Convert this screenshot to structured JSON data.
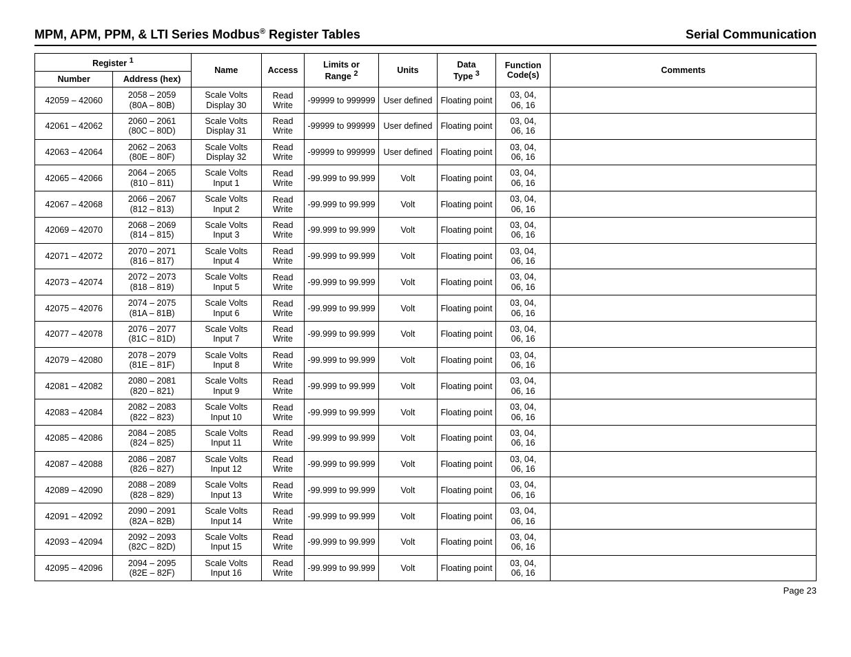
{
  "header": {
    "title_left_pre": "MPM, APM, PPM, & LTI Series Modbus",
    "title_left_post": " Register Tables",
    "reg_symbol": "®",
    "title_right": "Serial Communication"
  },
  "table": {
    "headers": {
      "register": "Register",
      "register_sup": "1",
      "number": "Number",
      "address": "Address (hex)",
      "name": "Name",
      "access": "Access",
      "limits_line1": "Limits or",
      "limits_line2": "Range",
      "limits_sup": "2",
      "units": "Units",
      "data_line1": "Data",
      "data_line2": "Type",
      "data_sup": "3",
      "function_line1": "Function",
      "function_line2": "Code(s)",
      "comments": "Comments"
    },
    "rows": [
      {
        "number": "42059 – 42060",
        "addr1": "2058 – 2059",
        "addr2": "(80A – 80B)",
        "name1": "Scale Volts",
        "name2": "Display 30",
        "access": "Read Write",
        "limits": "-99999 to 999999",
        "units": "User defined",
        "datatype": "Floating point",
        "func1": "03, 04,",
        "func2": "06, 16",
        "comments": ""
      },
      {
        "number": "42061 – 42062",
        "addr1": "2060 – 2061",
        "addr2": "(80C – 80D)",
        "name1": "Scale Volts",
        "name2": "Display 31",
        "access": "Read Write",
        "limits": "-99999 to 999999",
        "units": "User defined",
        "datatype": "Floating point",
        "func1": "03, 04,",
        "func2": "06, 16",
        "comments": ""
      },
      {
        "number": "42063 – 42064",
        "addr1": "2062 – 2063",
        "addr2": "(80E – 80F)",
        "name1": "Scale Volts",
        "name2": "Display 32",
        "access": "Read Write",
        "limits": "-99999 to 999999",
        "units": "User defined",
        "datatype": "Floating point",
        "func1": "03, 04,",
        "func2": "06, 16",
        "comments": ""
      },
      {
        "number": "42065 – 42066",
        "addr1": "2064 – 2065",
        "addr2": "(810 – 811)",
        "name1": "Scale Volts",
        "name2": "Input 1",
        "access": "Read Write",
        "limits": "-99.999 to 99.999",
        "units": "Volt",
        "datatype": "Floating point",
        "func1": "03, 04,",
        "func2": "06, 16",
        "comments": ""
      },
      {
        "number": "42067 – 42068",
        "addr1": "2066 – 2067",
        "addr2": "(812 – 813)",
        "name1": "Scale Volts",
        "name2": "Input 2",
        "access": "Read Write",
        "limits": "-99.999 to 99.999",
        "units": "Volt",
        "datatype": "Floating point",
        "func1": "03, 04,",
        "func2": "06, 16",
        "comments": ""
      },
      {
        "number": "42069 – 42070",
        "addr1": "2068 – 2069",
        "addr2": "(814 – 815)",
        "name1": "Scale Volts",
        "name2": "Input 3",
        "access": "Read Write",
        "limits": "-99.999 to 99.999",
        "units": "Volt",
        "datatype": "Floating point",
        "func1": "03, 04,",
        "func2": "06, 16",
        "comments": ""
      },
      {
        "number": "42071 – 42072",
        "addr1": "2070 – 2071",
        "addr2": "(816 – 817)",
        "name1": "Scale Volts",
        "name2": "Input 4",
        "access": "Read Write",
        "limits": "-99.999 to 99.999",
        "units": "Volt",
        "datatype": "Floating point",
        "func1": "03, 04,",
        "func2": "06, 16",
        "comments": ""
      },
      {
        "number": "42073 – 42074",
        "addr1": "2072 – 2073",
        "addr2": "(818 – 819)",
        "name1": "Scale Volts",
        "name2": "Input 5",
        "access": "Read Write",
        "limits": "-99.999 to 99.999",
        "units": "Volt",
        "datatype": "Floating point",
        "func1": "03, 04,",
        "func2": "06, 16",
        "comments": ""
      },
      {
        "number": "42075 – 42076",
        "addr1": "2074 – 2075",
        "addr2": "(81A – 81B)",
        "name1": "Scale Volts",
        "name2": "Input 6",
        "access": "Read Write",
        "limits": "-99.999 to 99.999",
        "units": "Volt",
        "datatype": "Floating point",
        "func1": "03, 04,",
        "func2": "06, 16",
        "comments": ""
      },
      {
        "number": "42077 – 42078",
        "addr1": "2076 – 2077",
        "addr2": "(81C – 81D)",
        "name1": "Scale Volts",
        "name2": "Input 7",
        "access": "Read Write",
        "limits": "-99.999 to 99.999",
        "units": "Volt",
        "datatype": "Floating point",
        "func1": "03, 04,",
        "func2": "06, 16",
        "comments": ""
      },
      {
        "number": "42079 – 42080",
        "addr1": "2078 – 2079",
        "addr2": "(81E – 81F)",
        "name1": "Scale Volts",
        "name2": "Input 8",
        "access": "Read Write",
        "limits": "-99.999 to 99.999",
        "units": "Volt",
        "datatype": "Floating point",
        "func1": "03, 04,",
        "func2": "06, 16",
        "comments": ""
      },
      {
        "number": "42081 – 42082",
        "addr1": "2080 – 2081",
        "addr2": "(820 – 821)",
        "name1": "Scale Volts",
        "name2": "Input 9",
        "access": "Read Write",
        "limits": "-99.999 to 99.999",
        "units": "Volt",
        "datatype": "Floating point",
        "func1": "03, 04,",
        "func2": "06, 16",
        "comments": ""
      },
      {
        "number": "42083 – 42084",
        "addr1": "2082 – 2083",
        "addr2": "(822 – 823)",
        "name1": "Scale Volts",
        "name2": "Input 10",
        "access": "Read Write",
        "limits": "-99.999 to 99.999",
        "units": "Volt",
        "datatype": "Floating point",
        "func1": "03, 04,",
        "func2": "06, 16",
        "comments": ""
      },
      {
        "number": "42085 – 42086",
        "addr1": "2084 – 2085",
        "addr2": "(824 – 825)",
        "name1": "Scale Volts",
        "name2": "Input 11",
        "access": "Read Write",
        "limits": "-99.999 to 99.999",
        "units": "Volt",
        "datatype": "Floating point",
        "func1": "03, 04,",
        "func2": "06, 16",
        "comments": ""
      },
      {
        "number": "42087 – 42088",
        "addr1": "2086 – 2087",
        "addr2": "(826 – 827)",
        "name1": "Scale Volts",
        "name2": "Input 12",
        "access": "Read Write",
        "limits": "-99.999 to 99.999",
        "units": "Volt",
        "datatype": "Floating point",
        "func1": "03, 04,",
        "func2": "06, 16",
        "comments": ""
      },
      {
        "number": "42089 – 42090",
        "addr1": "2088 – 2089",
        "addr2": "(828 – 829)",
        "name1": "Scale Volts",
        "name2": "Input 13",
        "access": "Read Write",
        "limits": "-99.999 to 99.999",
        "units": "Volt",
        "datatype": "Floating point",
        "func1": "03, 04,",
        "func2": "06, 16",
        "comments": ""
      },
      {
        "number": "42091 – 42092",
        "addr1": "2090 – 2091",
        "addr2": "(82A – 82B)",
        "name1": "Scale Volts",
        "name2": "Input 14",
        "access": "Read Write",
        "limits": "-99.999 to 99.999",
        "units": "Volt",
        "datatype": "Floating point",
        "func1": "03, 04,",
        "func2": "06, 16",
        "comments": ""
      },
      {
        "number": "42093 – 42094",
        "addr1": "2092 – 2093",
        "addr2": "(82C – 82D)",
        "name1": "Scale Volts",
        "name2": "Input 15",
        "access": "Read Write",
        "limits": "-99.999 to 99.999",
        "units": "Volt",
        "datatype": "Floating point",
        "func1": "03, 04,",
        "func2": "06, 16",
        "comments": ""
      },
      {
        "number": "42095 – 42096",
        "addr1": "2094 – 2095",
        "addr2": "(82E – 82F)",
        "name1": "Scale Volts",
        "name2": "Input 16",
        "access": "Read Write",
        "limits": "-99.999 to 99.999",
        "units": "Volt",
        "datatype": "Floating point",
        "func1": "03, 04,",
        "func2": "06, 16",
        "comments": ""
      }
    ]
  },
  "footer": {
    "page": "Page 23"
  }
}
